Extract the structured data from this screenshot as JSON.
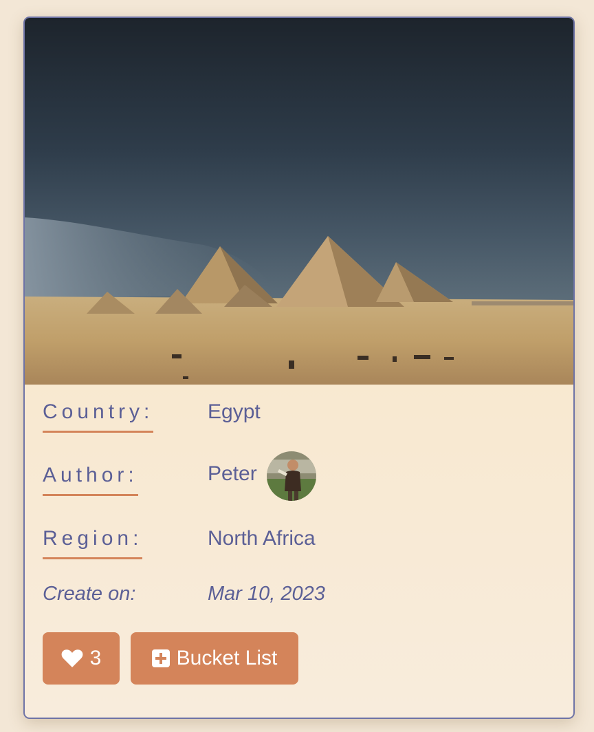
{
  "card": {
    "image_alt_icon": "pyramids-photo",
    "details": {
      "country_label": "Country:",
      "country_value": "Egypt",
      "author_label": "Author:",
      "author_value": "Peter",
      "region_label": "Region:",
      "region_value": "North Africa",
      "created_label": "Create on:",
      "created_value": "Mar 10, 2023"
    },
    "actions": {
      "like_icon": "heart-icon",
      "like_count": "3",
      "bucket_icon": "plus-square-icon",
      "bucket_label": "Bucket List"
    }
  },
  "colors": {
    "accent": "#d4845a",
    "text": "#5b5f96",
    "border": "#6e73a6",
    "page_bg": "#f3e7d6"
  }
}
